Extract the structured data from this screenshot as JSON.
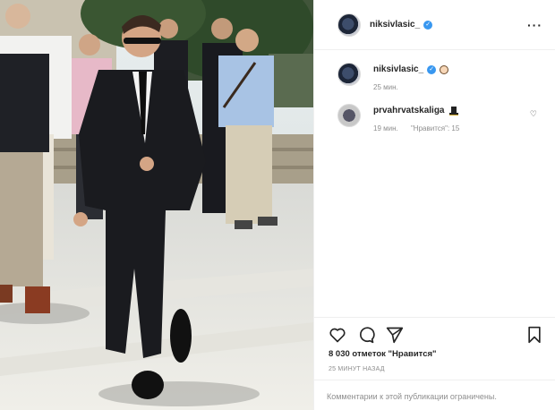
{
  "post": {
    "image_alt": "photo",
    "author": {
      "username": "niksivlasic_",
      "verified": true
    },
    "menu_icon": "more-horizontal-icon"
  },
  "comments": [
    {
      "username": "niksivlasic_",
      "verified": true,
      "emoji": "face-emoji",
      "time": "25 мин.",
      "likes": ""
    },
    {
      "username": "prvahrvatskaliga",
      "verified": false,
      "emoji": "top-hat-emoji",
      "time": "19 мин.",
      "likes": "\"Нравится\": 15"
    }
  ],
  "actions": {
    "icons": [
      "heart-icon",
      "comment-icon",
      "share-icon",
      "bookmark-icon"
    ],
    "likes_text": "8 030 отметок \"Нравится\"",
    "timestamp": "25 МИНУТ НАЗАД",
    "comments_limited": "Комментарии к этой публикации ограничены."
  },
  "colors": {
    "verified": "#3897f0",
    "muted": "#8e8e8e",
    "text": "#262626"
  }
}
